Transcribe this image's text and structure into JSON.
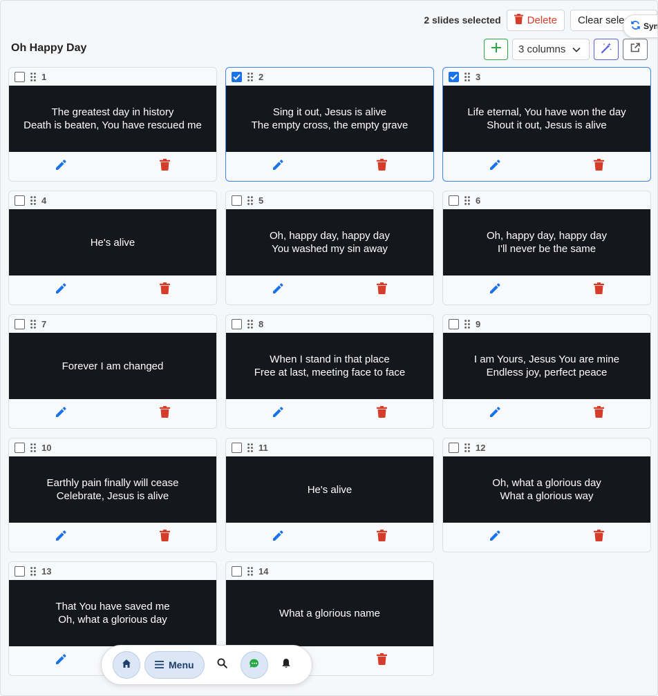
{
  "header": {
    "selection_text": "2 slides selected",
    "delete_label": "Delete",
    "clear_label": "Clear selection",
    "sync_label": "Sync"
  },
  "song": {
    "title": "Oh Happy Day"
  },
  "toolbar": {
    "columns_value": "3 columns",
    "add_icon": "plus-icon",
    "magic_icon": "magic-wand-icon",
    "external_icon": "external-link-icon"
  },
  "slides": [
    {
      "number": "1",
      "selected": false,
      "lines": [
        "The greatest day in history",
        "Death is beaten, You have rescued me"
      ]
    },
    {
      "number": "2",
      "selected": true,
      "lines": [
        "Sing it out, Jesus is alive",
        "The empty cross, the empty grave"
      ]
    },
    {
      "number": "3",
      "selected": true,
      "lines": [
        "Life eternal, You have won the day",
        "Shout it out, Jesus is alive"
      ]
    },
    {
      "number": "4",
      "selected": false,
      "lines": [
        "He's alive"
      ]
    },
    {
      "number": "5",
      "selected": false,
      "lines": [
        "Oh, happy day, happy day",
        "You washed my sin away"
      ]
    },
    {
      "number": "6",
      "selected": false,
      "lines": [
        "Oh, happy day, happy day",
        "I'll never be the same"
      ]
    },
    {
      "number": "7",
      "selected": false,
      "lines": [
        "Forever I am changed"
      ]
    },
    {
      "number": "8",
      "selected": false,
      "lines": [
        "When I stand in that place",
        "Free at last, meeting face to face"
      ]
    },
    {
      "number": "9",
      "selected": false,
      "lines": [
        "I am Yours, Jesus You are mine",
        "Endless joy, perfect peace"
      ]
    },
    {
      "number": "10",
      "selected": false,
      "lines": [
        "Earthly pain finally will cease",
        "Celebrate, Jesus is alive"
      ]
    },
    {
      "number": "11",
      "selected": false,
      "lines": [
        "He's alive"
      ]
    },
    {
      "number": "12",
      "selected": false,
      "lines": [
        "Oh, what a glorious day",
        "What a glorious way"
      ]
    },
    {
      "number": "13",
      "selected": false,
      "lines": [
        "That You have saved me",
        "Oh, what a glorious day"
      ]
    },
    {
      "number": "14",
      "selected": false,
      "lines": [
        "What a glorious name"
      ]
    }
  ],
  "bottom_nav": {
    "menu_label": "Menu"
  },
  "colors": {
    "selected_border": "#3b82f6",
    "delete_red": "#d63c2a",
    "edit_blue": "#1a73e8",
    "slide_bg": "#16171c",
    "add_green": "#27a844"
  }
}
